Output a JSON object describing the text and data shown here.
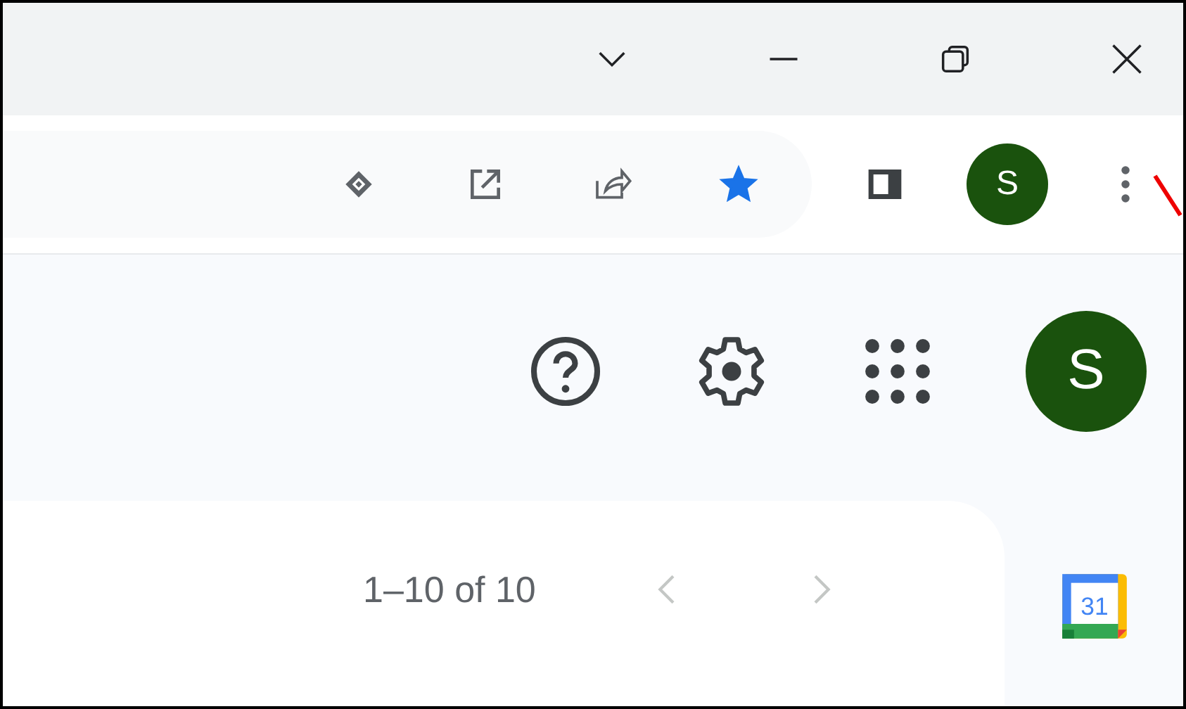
{
  "title_bar": {
    "buttons": [
      {
        "kind": "chevron"
      },
      {
        "kind": "minimize"
      },
      {
        "kind": "restore"
      },
      {
        "kind": "close"
      }
    ]
  },
  "toolbar": {
    "bookmarked": true,
    "profile_initial": "S"
  },
  "header": {
    "account_initial": "S"
  },
  "pagination": {
    "range": "1–10 of 10",
    "previous": {
      "disabled": true
    },
    "next": {
      "disabled": true
    }
  },
  "side_panel": {
    "calendar_day": "31"
  }
}
